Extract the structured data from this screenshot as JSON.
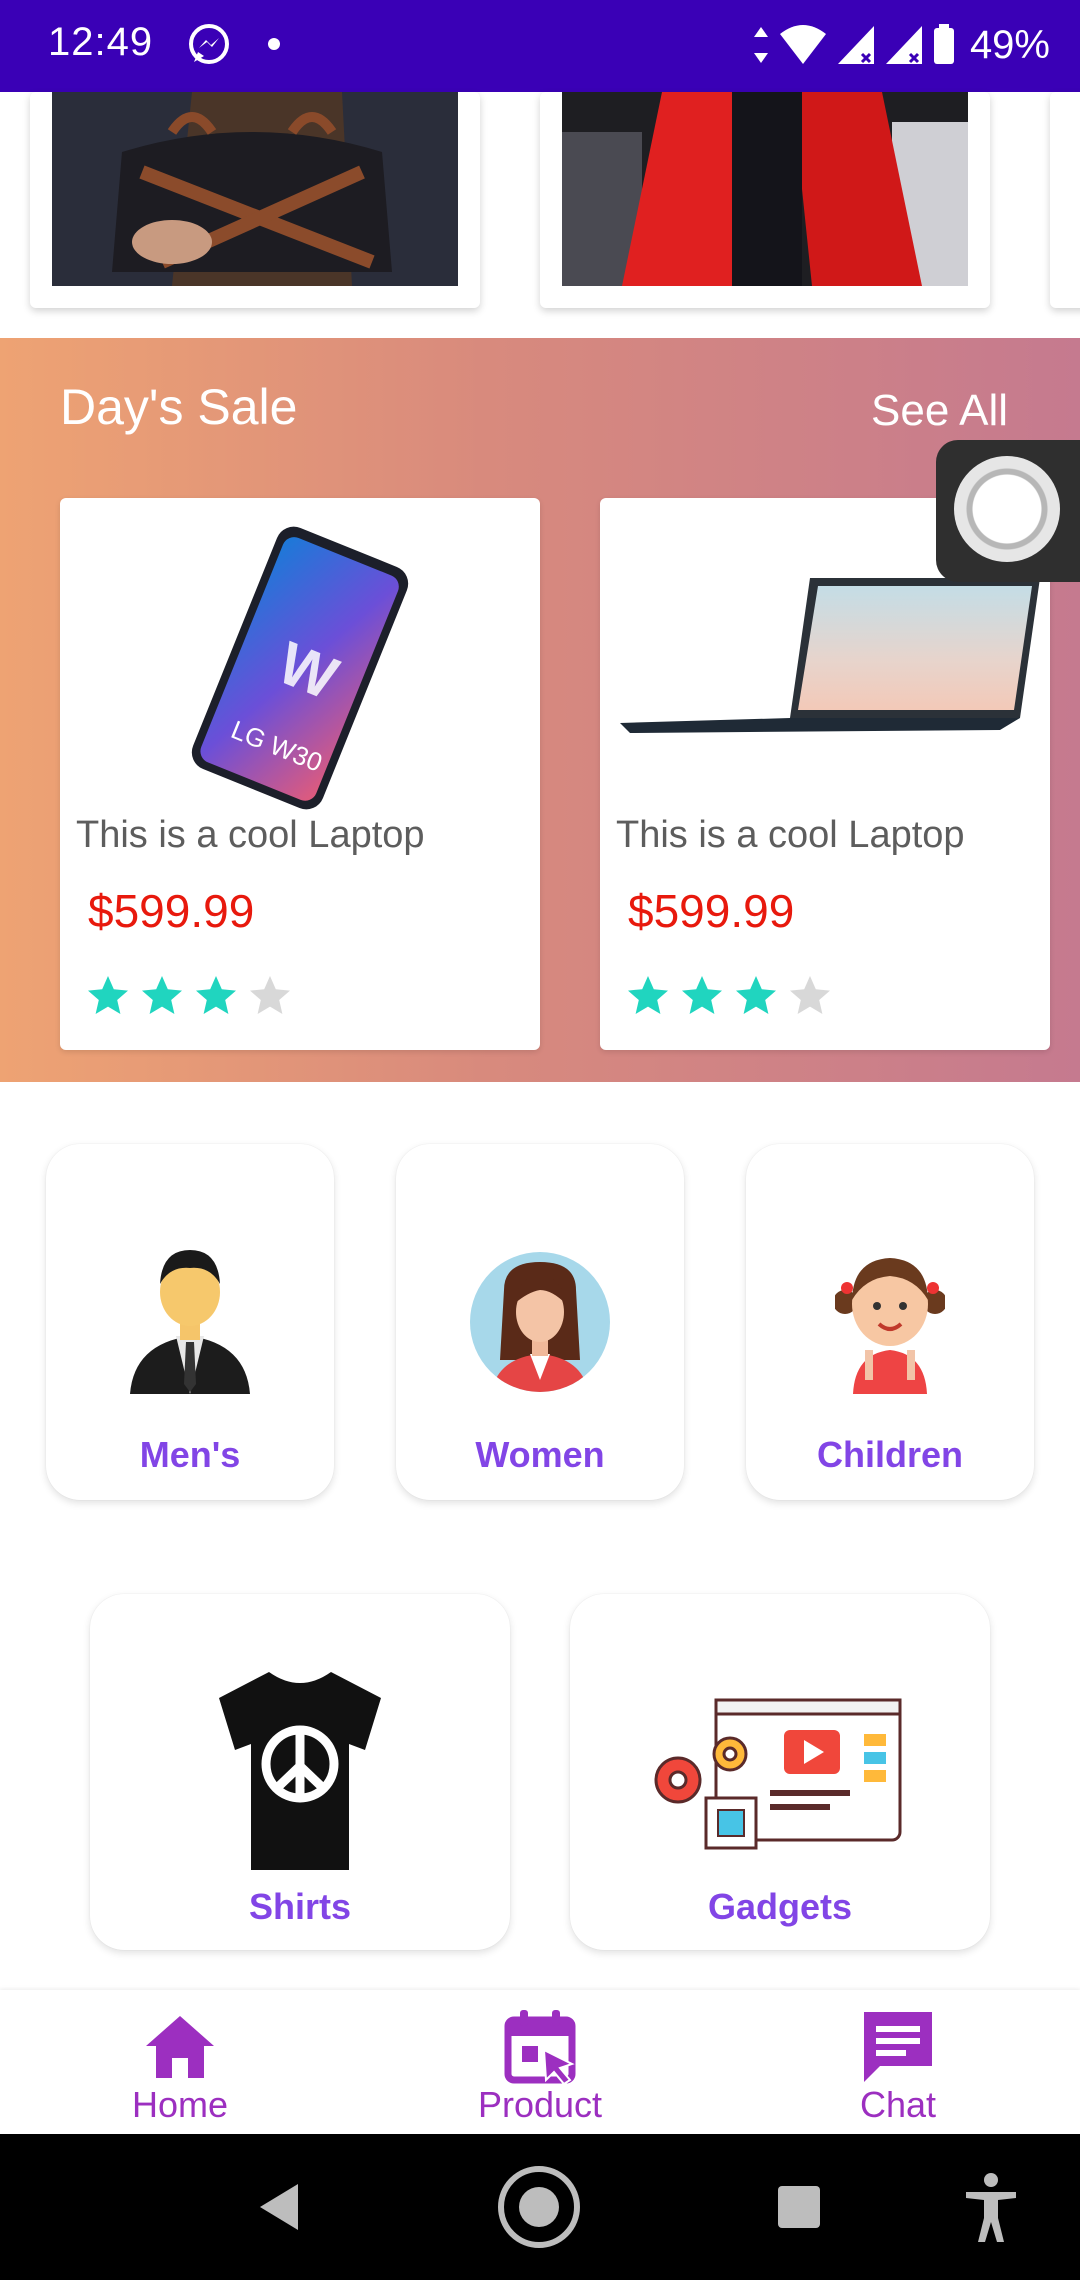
{
  "status_bar": {
    "time": "12:49",
    "battery": "49%",
    "bg_color": "#3a00b6"
  },
  "banner": {
    "items": [
      {
        "name": "bag-banner-image"
      },
      {
        "name": "red-coat-banner-image"
      }
    ]
  },
  "days_sale": {
    "title": "Day's Sale",
    "see_all": "See All",
    "products": [
      {
        "name": "This is a cool Laptop",
        "price": "$599.99",
        "rating": 3,
        "max_rating": 4,
        "image": "phone-icon"
      },
      {
        "name": "This is a cool Laptop",
        "price": "$599.99",
        "rating": 3,
        "max_rating": 4,
        "image": "laptop-icon"
      }
    ],
    "price_color": "#e8190d",
    "star_color": "#20d5bf"
  },
  "categories": {
    "row1": [
      {
        "label": "Men's",
        "icon": "man-icon"
      },
      {
        "label": "Women",
        "icon": "woman-icon"
      },
      {
        "label": "Children",
        "icon": "child-icon"
      }
    ],
    "row2": [
      {
        "label": "Shirts",
        "icon": "tshirt-icon"
      },
      {
        "label": "Gadgets",
        "icon": "gadgets-icon"
      }
    ],
    "label_color": "#8245e6"
  },
  "bottom_nav": {
    "items": [
      {
        "label": "Home",
        "icon": "home-icon"
      },
      {
        "label": "Product",
        "icon": "calendar-cursor-icon"
      },
      {
        "label": "Chat",
        "icon": "chat-icon"
      }
    ],
    "color": "#9c2fc0"
  },
  "system_nav": {
    "buttons": [
      "back-icon",
      "home-circle-icon",
      "recents-icon",
      "accessibility-icon"
    ]
  }
}
